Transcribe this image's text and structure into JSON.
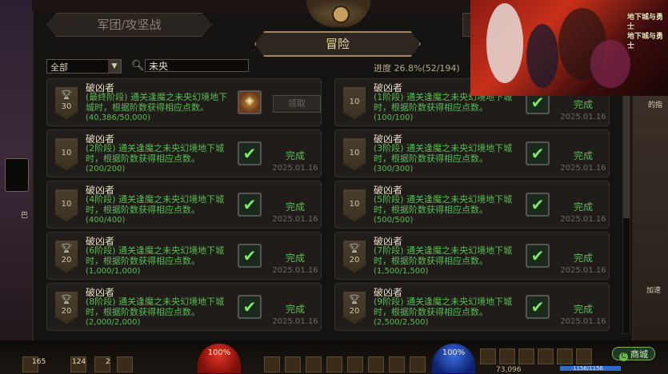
{
  "tabs": {
    "corps": "军团/攻坚战",
    "adventure": "冒险"
  },
  "filter": {
    "category": "全部",
    "search_value": "未央"
  },
  "progress_text": "进度 26.8%(52/194)",
  "cards": [
    {
      "name": "破凶者",
      "desc": "(最终阶段) 通关逢魔之未央幻境地下城时，根据阶数获得相应点数。",
      "count": "(40,386/50,000)",
      "points": "30",
      "cup": true,
      "state": "claim",
      "action_label": "领取",
      "action_icon": "reward-icon",
      "date": ""
    },
    {
      "name": "破凶者",
      "desc": "(1阶段) 通关逢魔之未央幻境地下城时，根据阶数获得相应点数。",
      "count": "(100/100)",
      "points": "10",
      "cup": false,
      "state": "done",
      "action_label": "完成",
      "action_icon": "check-icon",
      "date": "2025.01.16"
    },
    {
      "name": "破凶者",
      "desc": "(2阶段) 通关逢魔之未央幻境地下城时，根据阶数获得相应点数。",
      "count": "(200/200)",
      "points": "10",
      "cup": false,
      "state": "done",
      "action_label": "完成",
      "action_icon": "check-icon",
      "date": "2025.01.16"
    },
    {
      "name": "破凶者",
      "desc": "(3阶段) 通关逢魔之未央幻境地下城时，根据阶数获得相应点数。",
      "count": "(300/300)",
      "points": "10",
      "cup": false,
      "state": "done",
      "action_label": "完成",
      "action_icon": "check-icon",
      "date": "2025.01.16"
    },
    {
      "name": "破凶者",
      "desc": "(4阶段) 通关逢魔之未央幻境地下城时，根据阶数获得相应点数。",
      "count": "(400/400)",
      "points": "10",
      "cup": false,
      "state": "done",
      "action_label": "完成",
      "action_icon": "check-icon",
      "date": "2025.01.16"
    },
    {
      "name": "破凶者",
      "desc": "(5阶段) 通关逢魔之未央幻境地下城时，根据阶数获得相应点数。",
      "count": "(500/500)",
      "points": "10",
      "cup": false,
      "state": "done",
      "action_label": "完成",
      "action_icon": "check-icon",
      "date": "2025.01.16"
    },
    {
      "name": "破凶者",
      "desc": "(6阶段) 通关逢魔之未央幻境地下城时，根据阶数获得相应点数。",
      "count": "(1,000/1,000)",
      "points": "20",
      "cup": true,
      "state": "done",
      "action_label": "完成",
      "action_icon": "check-icon",
      "date": "2025.01.16"
    },
    {
      "name": "破凶者",
      "desc": "(7阶段) 通关逢魔之未央幻境地下城时，根据阶数获得相应点数。",
      "count": "(1,500/1,500)",
      "points": "20",
      "cup": true,
      "state": "done",
      "action_label": "完成",
      "action_icon": "check-icon",
      "date": "2025.01.16"
    },
    {
      "name": "破凶者",
      "desc": "(8阶段) 通关逢魔之未央幻境地下城时，根据阶数获得相应点数。",
      "count": "(2,000/2,000)",
      "points": "20",
      "cup": true,
      "state": "done",
      "action_label": "完成",
      "action_icon": "check-icon",
      "date": "2025.01.16"
    },
    {
      "name": "破凶者",
      "desc": "(9阶段) 通关逢魔之未央幻境地下城时，根据阶数获得相应点数。",
      "count": "(2,500/2,500)",
      "points": "20",
      "cup": true,
      "state": "done",
      "action_label": "完成",
      "action_icon": "check-icon",
      "date": "2025.01.16"
    }
  ],
  "ad": {
    "title_line1": "地下城与勇士",
    "title_line2": "地下城与勇士"
  },
  "hud": {
    "hp_orb": "100%",
    "mp_orb": "100%",
    "shop_label": "商城",
    "slot_count_1": "165",
    "slot_count_2": "124",
    "slot_count_3": "2",
    "hp_text": "1156/1156",
    "gold": "73,096"
  },
  "side_labels": {
    "left_1": "巴",
    "right_1": "的指",
    "right_2": "加速"
  },
  "colors": {
    "completed_green": "#5bbd54",
    "panel_bg": "#1f1c19",
    "active_tab_border": "#a6875a"
  }
}
